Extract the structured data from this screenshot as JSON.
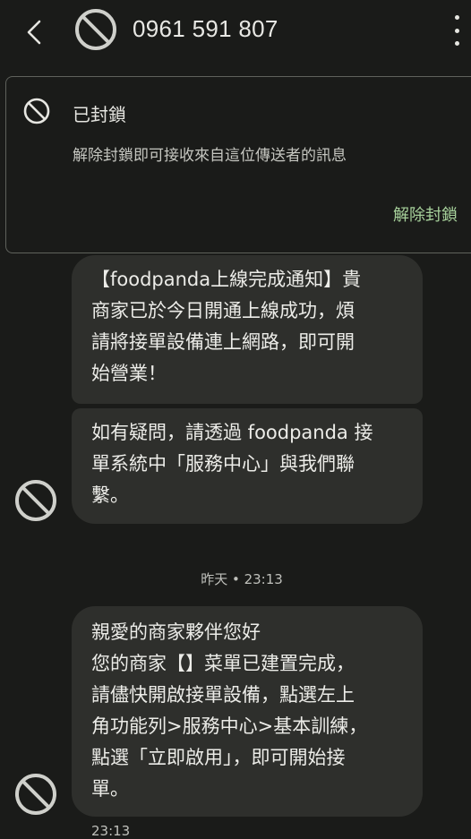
{
  "header": {
    "phone_number": "0961 591 807",
    "back_icon": "back-arrow-icon",
    "avatar_icon": "blocked-circle-icon",
    "more_icon": "more-vertical-icon"
  },
  "blocked_banner": {
    "title": "已封鎖",
    "description": "解除封鎖即可接收來自這位傳送者的訊息",
    "unblock_label": "解除封鎖",
    "icon": "blocked-circle-icon"
  },
  "messages": [
    {
      "text": "【foodpanda上線完成通知】貴\n商家已於今日開通上線成功，煩\n請將接單設備連上網路，即可開\n始營業！"
    },
    {
      "text": "如有疑問，請透過 foodpanda 接\n單系統中「服務中心」與我們聯\n繫。"
    },
    {
      "text": "親愛的商家夥伴您好\n您的商家【】菜單已建置完成，\n請儘快開啟接單設備，點選左上\n角功能列>服務中心>基本訓練，\n點選「立即啟用」，即可開始接\n單。"
    }
  ],
  "day_separator": "昨天 • 23:13",
  "last_message_time": "23:13",
  "colors": {
    "background": "#1a1b19",
    "bubble": "#2e2f2c",
    "accent": "#a7d19b"
  }
}
